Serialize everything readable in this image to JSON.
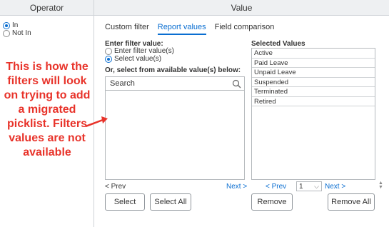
{
  "header": {
    "operator": "Operator",
    "value": "Value"
  },
  "operators": [
    {
      "label": "In",
      "selected": true
    },
    {
      "label": "Not In",
      "selected": false
    }
  ],
  "annotation": "This is how the filters will look on trying to add a migrated picklist. Filters values are not available",
  "tabs": [
    {
      "label": "Custom filter",
      "active": false
    },
    {
      "label": "Report values",
      "active": true
    },
    {
      "label": "Field comparison",
      "active": false
    }
  ],
  "left": {
    "enter_label": "Enter filter value:",
    "options": [
      {
        "label": "Enter filter value(s)",
        "selected": false
      },
      {
        "label": "Select value(s)",
        "selected": true
      }
    ],
    "or_label": "Or, select from available value(s) below:",
    "search_placeholder": "Search",
    "prev": "< Prev",
    "next": "Next >"
  },
  "right": {
    "title": "Selected Values",
    "values": [
      "Active",
      "Paid Leave",
      "Unpaid Leave",
      "Suspended",
      "Terminated",
      "Retired"
    ],
    "prev": "< Prev",
    "page": "1",
    "next": "Next >"
  },
  "buttons": {
    "select": "Select",
    "select_all": "Select All",
    "remove": "Remove",
    "remove_all": "Remove All"
  },
  "colors": {
    "accent": "#0a6ed1",
    "annotation": "#e8332a"
  }
}
